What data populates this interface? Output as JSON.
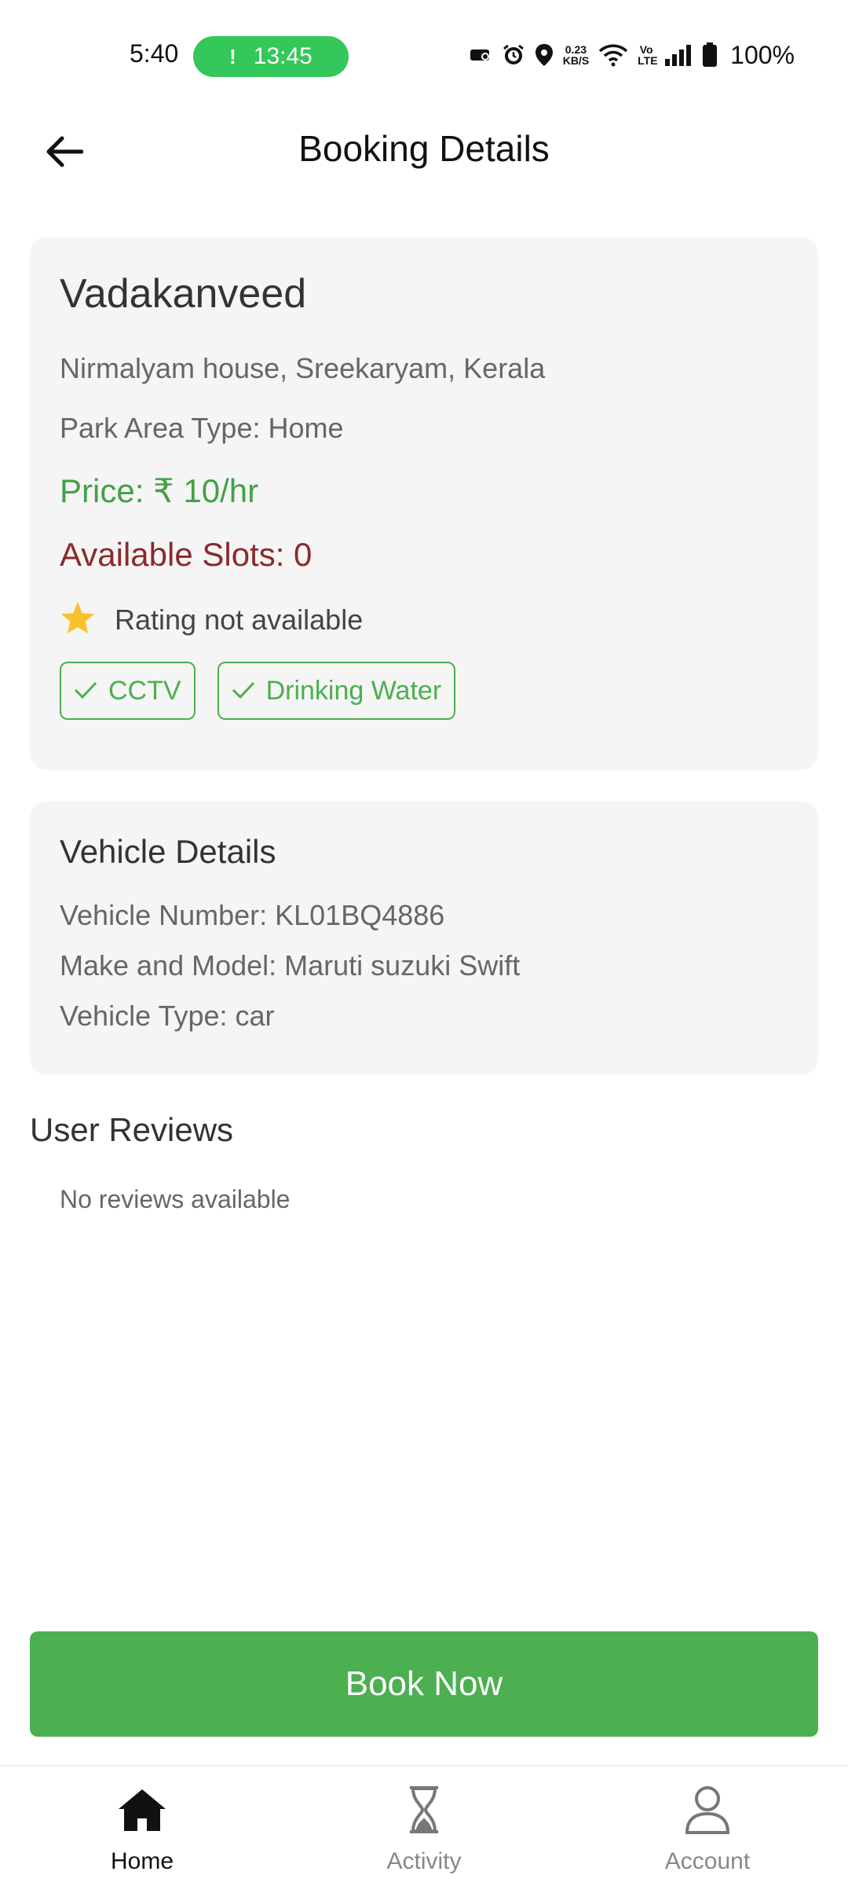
{
  "status_bar": {
    "time": "5:40",
    "call_timer": "13:45",
    "call_indicator": "!",
    "net_speed_value": "0.23",
    "net_speed_unit": "KB/S",
    "volte": "Vo LTE",
    "battery": "100%",
    "icons": [
      "car-mode-icon",
      "alarm-icon",
      "location-icon",
      "wifi-icon",
      "volte-icon",
      "signal-icon",
      "battery-icon"
    ]
  },
  "header": {
    "title": "Booking Details",
    "back_icon": "arrow-left-icon"
  },
  "parking": {
    "name": "Vadakanveed",
    "address": "Nirmalyam house, Sreekaryam, Kerala",
    "area_type": "Park Area Type: Home",
    "price": "Price: ₹ 10/hr",
    "slots": "Available Slots: 0",
    "rating": "Rating not available",
    "rating_icon": "star-icon",
    "amenities": [
      "CCTV",
      "Drinking Water"
    ]
  },
  "vehicle": {
    "title": "Vehicle Details",
    "number": "Vehicle Number: KL01BQ4886",
    "make_model": "Make and Model: Maruti suzuki Swift",
    "type": "Vehicle Type: car"
  },
  "reviews": {
    "title": "User Reviews",
    "empty_text": "No reviews available"
  },
  "actions": {
    "book_label": "Book Now"
  },
  "bottom_nav": {
    "items": [
      {
        "label": "Home",
        "icon": "home-icon",
        "active": true
      },
      {
        "label": "Activity",
        "icon": "hourglass-icon",
        "active": false
      },
      {
        "label": "Account",
        "icon": "person-icon",
        "active": false
      }
    ]
  },
  "colors": {
    "accent_green": "#4caf50",
    "price_green": "#43a047",
    "slots_red": "#8b2a2a",
    "star_yellow": "#fbc02d",
    "card_bg": "#f5f5f5"
  }
}
